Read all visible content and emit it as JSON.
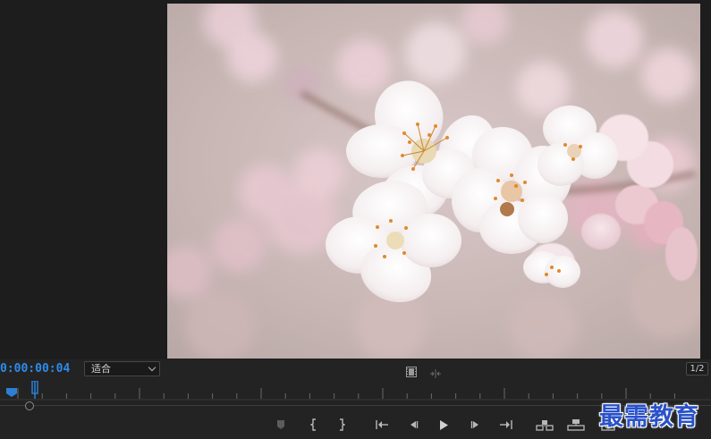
{
  "monitor": {
    "preview_image": "blossom-photo",
    "timecode": "0:00:00:04",
    "fit_select": {
      "value": "适合"
    },
    "resolution": "1/2"
  },
  "transport": {
    "buttons": [
      {
        "name": "marker-icon"
      },
      {
        "name": "mark-in-icon"
      },
      {
        "name": "mark-out-icon"
      },
      {
        "name": "go-to-in-icon"
      },
      {
        "name": "step-back-icon"
      },
      {
        "name": "play-icon"
      },
      {
        "name": "step-forward-icon"
      },
      {
        "name": "go-to-out-icon"
      },
      {
        "name": "insert-icon"
      },
      {
        "name": "overwrite-icon"
      },
      {
        "name": "export-frame-icon"
      }
    ]
  },
  "watermark": {
    "text": "最需教育"
  },
  "colors": {
    "timecode": "#2d8ceb",
    "playhead": "#2d7fd6",
    "background": "#1d1d1d"
  }
}
